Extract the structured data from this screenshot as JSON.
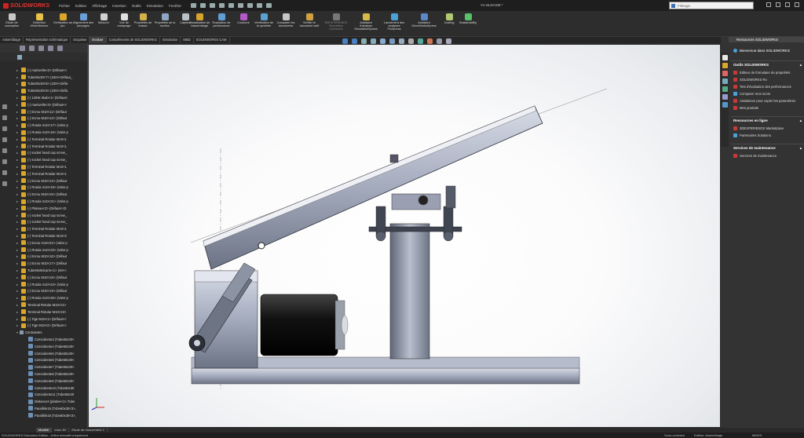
{
  "app": {
    "brand": "SOLIDWORKS",
    "doc_title": "V1-SLDASM *"
  },
  "menu": [
    "Fichier",
    "Edition",
    "Affichage",
    "Insertion",
    "Outils",
    "Simulation",
    "Fenêtre"
  ],
  "search": {
    "placeholder": "Filetage"
  },
  "ribbon": [
    {
      "label": "Etude de conception",
      "color": "#c8c8c8"
    },
    {
      "label": "Détection d'interférence",
      "color": "#e9c24a"
    },
    {
      "label": "Vérification du jeu",
      "color": "#d9a62a"
    },
    {
      "label": "Alignement des perçages",
      "color": "#6aa0d8"
    },
    {
      "label": "Mesurer",
      "color": "#d1d1d1"
    },
    {
      "label": "Vue de marquage",
      "color": "#e0e0e0"
    },
    {
      "label": "Propriétés de masse",
      "color": "#d3b04a"
    },
    {
      "label": "Propriétés de la section",
      "color": "#8ea6c4"
    },
    {
      "label": "Capteur",
      "color": "#b8c0c8"
    },
    {
      "label": "Visualisation de l'assemblage",
      "color": "#d6a42a"
    },
    {
      "label": "Evaluation de performance",
      "color": "#5f9fd6"
    },
    {
      "label": "Courbure",
      "color": "#b25ac8"
    },
    {
      "label": "Vérification de la symétrie",
      "color": "#5aa0d0"
    },
    {
      "label": "Comparer les documents",
      "color": "#c7c7c7"
    },
    {
      "label": "Vérifier le document actif",
      "color": "#d0a040"
    },
    {
      "label": "3DEXPERIENCE Simulation Connector",
      "color": "#777777"
    },
    {
      "label": "Assistant d'analyse SimulationXpress",
      "color": "#d8b84a"
    },
    {
      "label": "Lancement des analyses FloXpress",
      "color": "#4ba0d8"
    },
    {
      "label": "Assistant DriveWorksXpress",
      "color": "#5c88c8"
    },
    {
      "label": "Costing",
      "color": "#b0c870"
    },
    {
      "label": "Sustainability",
      "color": "#5ac06a"
    }
  ],
  "tabs": [
    "Assemblage",
    "Représentation schématique",
    "Esquisse",
    "Evaluer",
    "Compléments de SOLIDWORKS",
    "Simulation",
    "MBD",
    "SOLIDWORKS CAM"
  ],
  "active_tab": "Evaluer",
  "tree": [
    {
      "text": "(-) manivelle<2> (Défaut<<",
      "kind": "part"
    },
    {
      "text": "Tube60x30<7> (340<<Défaut_",
      "kind": "part"
    },
    {
      "text": "Tube60x30<8> (100<<Défa",
      "kind": "part"
    },
    {
      "text": "Tube60x30<9> (100<<Défa",
      "kind": "part"
    },
    {
      "text": "(-) 120W dsab<1> (Défaut<",
      "kind": "part"
    },
    {
      "text": "(-) manivelle<4> (Défaut<<",
      "kind": "part"
    },
    {
      "text": "(-) Ecrou M10<11> (Défaut",
      "kind": "part"
    },
    {
      "text": "(-) Ecrou M10<12> (Défaut",
      "kind": "part"
    },
    {
      "text": "(-) Rotula m10<17> (Valor p",
      "kind": "part"
    },
    {
      "text": "(-) Rotula m10<18> (Valor p",
      "kind": "part"
    },
    {
      "text": "(-) Terminal Rotular M10<1",
      "kind": "part"
    },
    {
      "text": "(-) Terminal Rotular M10<1",
      "kind": "part"
    },
    {
      "text": "(-) socket head cap screw_",
      "kind": "part"
    },
    {
      "text": "(-) socket head cap screw_",
      "kind": "part"
    },
    {
      "text": "(-) Terminal Rotular M10<1",
      "kind": "part"
    },
    {
      "text": "(-) Terminal Rotular M10<1",
      "kind": "part"
    },
    {
      "text": "(-) Ecrou M10<13> (Défaut",
      "kind": "part"
    },
    {
      "text": "(-) Rotula m10<19> (Valor p",
      "kind": "part"
    },
    {
      "text": "(-) Ecrou M10<15> (Défaut",
      "kind": "part"
    },
    {
      "text": "(-) Rotula m10<21> (Valor p",
      "kind": "part"
    },
    {
      "text": "(-) Plateau<3> (Défaut<<D",
      "kind": "part"
    },
    {
      "text": "(-) socket head cap screw_",
      "kind": "part"
    },
    {
      "text": "(-) socket head cap screw_",
      "kind": "part"
    },
    {
      "text": "(-) Terminal Rotular M10<1",
      "kind": "part"
    },
    {
      "text": "(-) Terminal Rotular M10<2",
      "kind": "part"
    },
    {
      "text": "(-) Ecrou m10<22> (Valor p",
      "kind": "part"
    },
    {
      "text": "(-) Rotula m10<23> (Valor p",
      "kind": "part"
    },
    {
      "text": "(-) Ecrou M10<16> (Défaut",
      "kind": "part"
    },
    {
      "text": "(-) Ecrou M10<17> (Défaut",
      "kind": "part"
    },
    {
      "text": "Tube60x60carre<1> (40<<",
      "kind": "part"
    },
    {
      "text": "(-) Ecrou M10<18> (Défaut",
      "kind": "part"
    },
    {
      "text": "(-) Rotula m10<24> (Valor p",
      "kind": "part"
    },
    {
      "text": "(-) Ecrou M10<19> (Défaut",
      "kind": "part"
    },
    {
      "text": "(-) Rotula m10<25> (Valor p",
      "kind": "part"
    },
    {
      "text": "Terminal Rotular M10<21>",
      "kind": "part"
    },
    {
      "text": "Terminal Rotular M10<22>",
      "kind": "part"
    },
    {
      "text": "(-) Tige M10<1> (Défaut<<",
      "kind": "part"
    },
    {
      "text": "(-) Tige M10<2> (Défaut<<",
      "kind": "part"
    },
    {
      "text": "Contraintes",
      "kind": "folder"
    },
    {
      "text": "Coïncidente3 (Tube60x30<",
      "kind": "mate"
    },
    {
      "text": "Coïncidente4 (Tube60x30<",
      "kind": "mate"
    },
    {
      "text": "Coïncidente5 (Tube60x30<",
      "kind": "mate"
    },
    {
      "text": "Coïncidente6 (Tube60x30<",
      "kind": "mate"
    },
    {
      "text": "Coïncidente7 (Tube60x30<",
      "kind": "mate"
    },
    {
      "text": "Coïncidente8 (Tube60x30<",
      "kind": "mate"
    },
    {
      "text": "Coïncidente9 (Tube60x30<",
      "kind": "mate"
    },
    {
      "text": "Coïncidente10 (Tube60x30",
      "kind": "mate"
    },
    {
      "text": "Coïncidente11 (Tube60x30",
      "kind": "mate"
    },
    {
      "text": "Distance3 (platine<1>,Tube",
      "kind": "mate"
    },
    {
      "text": "Parallèle15 (Tube60x30<3>,",
      "kind": "mate"
    },
    {
      "text": "Parallèle16 (Tube60x30<3>,",
      "kind": "mate"
    }
  ],
  "bottom_tabs": [
    "Modèle",
    "Vues 3D",
    "Etude de mouvement 2"
  ],
  "status": {
    "left": "SOLIDWORKS Education Edition - A titre éducatif uniquement",
    "constraint": "Sous-contraint",
    "mode": "Edition: Assemblage",
    "units": "MMGS"
  },
  "taskpane": {
    "header": "Ressources SOLIDWORKS",
    "welcome": "Bienvenue dans SOLIDWORKS",
    "sections": [
      {
        "title": "Outils SOLIDWORKS",
        "items": [
          {
            "label": "Editeur de formulaire de propriétés",
            "color": "#c83a3a"
          },
          {
            "label": "SOLIDWORKS Rx",
            "color": "#c83a3a"
          },
          {
            "label": "Test d'évaluation des performances",
            "color": "#c83a3a"
          },
          {
            "label": "Comparer mon score",
            "color": "#4aa3df"
          },
          {
            "label": "Assistance pour copier les paramètres",
            "color": "#c83a3a"
          },
          {
            "label": "Mes produits",
            "color": "#c83a3a"
          }
        ]
      },
      {
        "title": "Ressources en ligne",
        "items": [
          {
            "label": "3DEXPERIENCE Marketplace",
            "color": "#c83a3a"
          },
          {
            "label": "Partenaires Solutions",
            "color": "#4aa3df"
          }
        ]
      },
      {
        "title": "Services de maintenance",
        "items": [
          {
            "label": "Services de maintenance",
            "color": "#c83a3a"
          }
        ]
      }
    ]
  }
}
